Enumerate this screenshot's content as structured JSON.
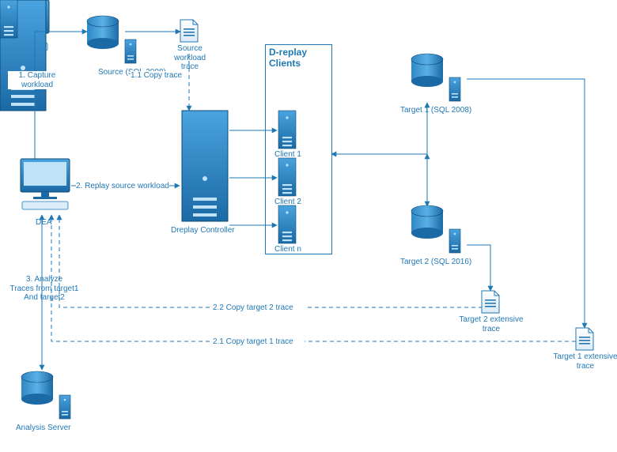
{
  "nodes": {
    "dea": {
      "label": "DEA"
    },
    "source": {
      "label": "Source (SQL 2008)"
    },
    "source_trace": {
      "label": "Source workload\ntrace"
    },
    "dreplay": {
      "label": "Dreplay Controller"
    },
    "clients_box": {
      "label": "D-replay\nClients"
    },
    "client1": {
      "label": "Client 1"
    },
    "client2": {
      "label": "Client 2"
    },
    "clientn": {
      "label": "Client n"
    },
    "target1": {
      "label": "Target 1 (SQL 2008)"
    },
    "target2": {
      "label": "Target 2 (SQL 2016)"
    },
    "t1_trace": {
      "label": "Target 1 extensive\ntrace"
    },
    "t2_trace": {
      "label": "Target 2 extensive\ntrace"
    },
    "analysis": {
      "label": "Analysis Server"
    }
  },
  "edges": {
    "e1": {
      "label": "1. Capture workload"
    },
    "e1_1": {
      "label": "1.1 Copy trace"
    },
    "e2": {
      "label": "2. Replay source workload"
    },
    "e2_1": {
      "label": "2.1 Copy target 1 trace"
    },
    "e2_2": {
      "label": "2.2 Copy target 2 trace"
    },
    "e3": {
      "label": "3. Analyze\nTraces from target1\nAnd target2"
    }
  },
  "chart_data": {
    "type": "diagram",
    "title": "",
    "nodes": [
      {
        "id": "dea",
        "label": "DEA",
        "kind": "workstation"
      },
      {
        "id": "source",
        "label": "Source (SQL 2008)",
        "kind": "db-server"
      },
      {
        "id": "source_trace",
        "label": "Source workload trace",
        "kind": "document"
      },
      {
        "id": "dreplay",
        "label": "Dreplay Controller",
        "kind": "server"
      },
      {
        "id": "clients_box",
        "label": "D-replay Clients",
        "kind": "group"
      },
      {
        "id": "client1",
        "label": "Client 1",
        "kind": "server",
        "group": "clients_box"
      },
      {
        "id": "client2",
        "label": "Client 2",
        "kind": "server",
        "group": "clients_box"
      },
      {
        "id": "clientn",
        "label": "Client n",
        "kind": "server",
        "group": "clients_box"
      },
      {
        "id": "target1",
        "label": "Target 1 (SQL 2008)",
        "kind": "db-server"
      },
      {
        "id": "target2",
        "label": "Target 2 (SQL 2016)",
        "kind": "db-server"
      },
      {
        "id": "t1_trace",
        "label": "Target 1 extensive trace",
        "kind": "document"
      },
      {
        "id": "t2_trace",
        "label": "Target 2 extensive trace",
        "kind": "document"
      },
      {
        "id": "analysis",
        "label": "Analysis Server",
        "kind": "db-server"
      }
    ],
    "edges": [
      {
        "from": "dea",
        "to": "source",
        "label": "1. Capture workload",
        "style": "solid"
      },
      {
        "from": "source",
        "to": "source_trace",
        "label": "",
        "style": "solid"
      },
      {
        "from": "source_trace",
        "to": "dreplay",
        "label": "1.1 Copy trace",
        "style": "dashed"
      },
      {
        "from": "dea",
        "to": "dreplay",
        "label": "2. Replay source workload",
        "style": "solid"
      },
      {
        "from": "dreplay",
        "to": "client1",
        "label": "",
        "style": "solid"
      },
      {
        "from": "dreplay",
        "to": "client2",
        "label": "",
        "style": "solid"
      },
      {
        "from": "dreplay",
        "to": "clientn",
        "label": "",
        "style": "solid"
      },
      {
        "from": "clients_box",
        "to": "target1",
        "label": "",
        "style": "solid",
        "bidir": true
      },
      {
        "from": "clients_box",
        "to": "target2",
        "label": "",
        "style": "solid",
        "bidir": true
      },
      {
        "from": "target1",
        "to": "t1_trace",
        "label": "",
        "style": "solid"
      },
      {
        "from": "target2",
        "to": "t2_trace",
        "label": "",
        "style": "solid"
      },
      {
        "from": "t1_trace",
        "to": "dea",
        "label": "2.1 Copy target 1 trace",
        "style": "dashed"
      },
      {
        "from": "t2_trace",
        "to": "dea",
        "label": "2.2 Copy target 2 trace",
        "style": "dashed"
      },
      {
        "from": "analysis",
        "to": "dea",
        "label": "3. Analyze Traces from target1 And target2",
        "style": "solid",
        "bidir": true
      }
    ]
  }
}
